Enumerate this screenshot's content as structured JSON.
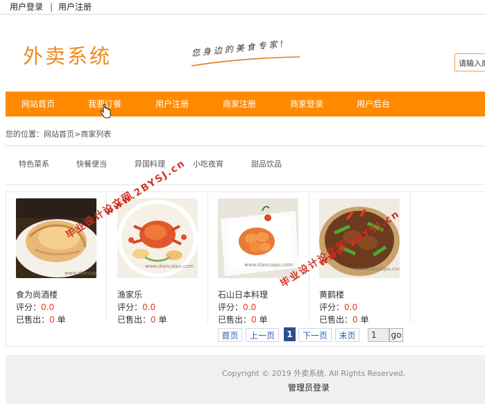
{
  "topbar": {
    "login": "用户登录",
    "separator": "|",
    "register": "用户注册"
  },
  "header": {
    "logo": "外卖系统",
    "slogan": "您身边的美食专家!",
    "search_placeholder": "请输入商"
  },
  "nav": [
    "网站首页",
    "我要订餐",
    "用户注册",
    "商家注册",
    "商家登录",
    "用户后台"
  ],
  "breadcrumb": "您的位置：网站首页>商家列表",
  "categories": [
    "特色菜系",
    "快餐便当",
    "异国料理",
    "小吃夜宵",
    "甜品饮品"
  ],
  "restaurants": [
    {
      "name": "食为尚酒楼",
      "rating_label": "评分：",
      "rating": "0.0",
      "sold_label": "已售出：",
      "sold": "0",
      "unit": " 单"
    },
    {
      "name": "渔家乐",
      "rating_label": "评分：",
      "rating": "0.0",
      "sold_label": "已售出：",
      "sold": "0",
      "unit": " 单"
    },
    {
      "name": "石山日本料理",
      "rating_label": "评分：",
      "rating": "0.0",
      "sold_label": "已售出：",
      "sold": "0",
      "unit": " 单"
    },
    {
      "name": "黄鹤楼",
      "rating_label": "评分：",
      "rating": "0.0",
      "sold_label": "已售出：",
      "sold": "0",
      "unit": " 单"
    }
  ],
  "pager": {
    "first": "首页",
    "prev": "上一页",
    "current": "1",
    "next": "下一页",
    "last": "末页",
    "page_input": "1",
    "go": "go"
  },
  "footer": {
    "copyright": "Copyright © 2019 外卖系统. All Rights Reserved.",
    "admin_login": "管理员登录"
  },
  "watermarks": [
    {
      "a": "毕业设计论文网",
      "b": "www.2BYSJ.cn"
    },
    {
      "a": "毕业设计论文网",
      "b": "www.2BYSJ.cn"
    }
  ],
  "image_watermark": "www.diancaipu.com",
  "colors": {
    "accent": "#ff8a00",
    "logo": "#f08a1c",
    "value_red": "#e83b1e",
    "pager_current": "#2c4f92",
    "watermark": "#d42a1e"
  }
}
